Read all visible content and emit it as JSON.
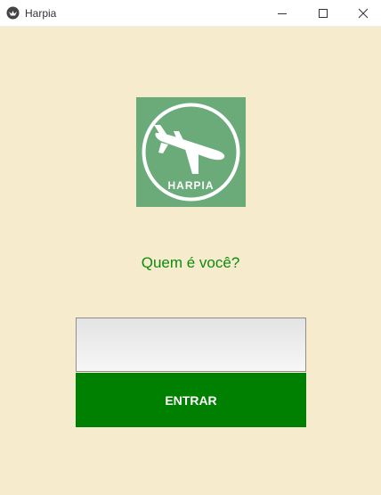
{
  "window": {
    "title": "Harpia",
    "app_icon": "harpia-bird-icon",
    "controls": [
      "minimize-icon",
      "maximize-icon",
      "close-icon"
    ]
  },
  "logo": {
    "text": "HARPIA",
    "background_color": "#6aab79",
    "icon": "airplane-icon"
  },
  "prompt": {
    "text": "Quem é você?",
    "color": "#0c8c0c"
  },
  "name_field": {
    "value": "",
    "placeholder": ""
  },
  "submit": {
    "label": "ENTRAR",
    "color": "#008000"
  },
  "background_color": "#f6ebcd"
}
